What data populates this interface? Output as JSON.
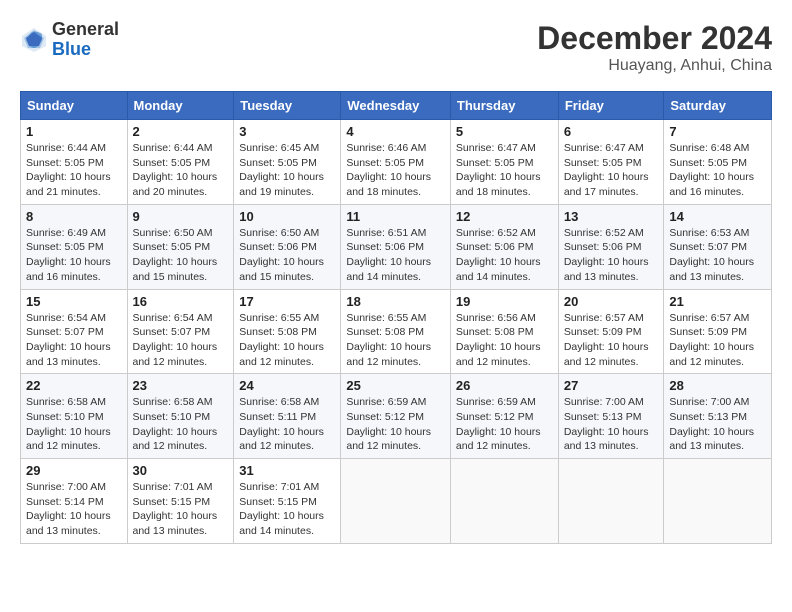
{
  "header": {
    "logo_general": "General",
    "logo_blue": "Blue",
    "month_title": "December 2024",
    "location": "Huayang, Anhui, China"
  },
  "days_of_week": [
    "Sunday",
    "Monday",
    "Tuesday",
    "Wednesday",
    "Thursday",
    "Friday",
    "Saturday"
  ],
  "weeks": [
    [
      {
        "day": "1",
        "info": "Sunrise: 6:44 AM\nSunset: 5:05 PM\nDaylight: 10 hours\nand 21 minutes."
      },
      {
        "day": "2",
        "info": "Sunrise: 6:44 AM\nSunset: 5:05 PM\nDaylight: 10 hours\nand 20 minutes."
      },
      {
        "day": "3",
        "info": "Sunrise: 6:45 AM\nSunset: 5:05 PM\nDaylight: 10 hours\nand 19 minutes."
      },
      {
        "day": "4",
        "info": "Sunrise: 6:46 AM\nSunset: 5:05 PM\nDaylight: 10 hours\nand 18 minutes."
      },
      {
        "day": "5",
        "info": "Sunrise: 6:47 AM\nSunset: 5:05 PM\nDaylight: 10 hours\nand 18 minutes."
      },
      {
        "day": "6",
        "info": "Sunrise: 6:47 AM\nSunset: 5:05 PM\nDaylight: 10 hours\nand 17 minutes."
      },
      {
        "day": "7",
        "info": "Sunrise: 6:48 AM\nSunset: 5:05 PM\nDaylight: 10 hours\nand 16 minutes."
      }
    ],
    [
      {
        "day": "8",
        "info": "Sunrise: 6:49 AM\nSunset: 5:05 PM\nDaylight: 10 hours\nand 16 minutes."
      },
      {
        "day": "9",
        "info": "Sunrise: 6:50 AM\nSunset: 5:05 PM\nDaylight: 10 hours\nand 15 minutes."
      },
      {
        "day": "10",
        "info": "Sunrise: 6:50 AM\nSunset: 5:06 PM\nDaylight: 10 hours\nand 15 minutes."
      },
      {
        "day": "11",
        "info": "Sunrise: 6:51 AM\nSunset: 5:06 PM\nDaylight: 10 hours\nand 14 minutes."
      },
      {
        "day": "12",
        "info": "Sunrise: 6:52 AM\nSunset: 5:06 PM\nDaylight: 10 hours\nand 14 minutes."
      },
      {
        "day": "13",
        "info": "Sunrise: 6:52 AM\nSunset: 5:06 PM\nDaylight: 10 hours\nand 13 minutes."
      },
      {
        "day": "14",
        "info": "Sunrise: 6:53 AM\nSunset: 5:07 PM\nDaylight: 10 hours\nand 13 minutes."
      }
    ],
    [
      {
        "day": "15",
        "info": "Sunrise: 6:54 AM\nSunset: 5:07 PM\nDaylight: 10 hours\nand 13 minutes."
      },
      {
        "day": "16",
        "info": "Sunrise: 6:54 AM\nSunset: 5:07 PM\nDaylight: 10 hours\nand 12 minutes."
      },
      {
        "day": "17",
        "info": "Sunrise: 6:55 AM\nSunset: 5:08 PM\nDaylight: 10 hours\nand 12 minutes."
      },
      {
        "day": "18",
        "info": "Sunrise: 6:55 AM\nSunset: 5:08 PM\nDaylight: 10 hours\nand 12 minutes."
      },
      {
        "day": "19",
        "info": "Sunrise: 6:56 AM\nSunset: 5:08 PM\nDaylight: 10 hours\nand 12 minutes."
      },
      {
        "day": "20",
        "info": "Sunrise: 6:57 AM\nSunset: 5:09 PM\nDaylight: 10 hours\nand 12 minutes."
      },
      {
        "day": "21",
        "info": "Sunrise: 6:57 AM\nSunset: 5:09 PM\nDaylight: 10 hours\nand 12 minutes."
      }
    ],
    [
      {
        "day": "22",
        "info": "Sunrise: 6:58 AM\nSunset: 5:10 PM\nDaylight: 10 hours\nand 12 minutes."
      },
      {
        "day": "23",
        "info": "Sunrise: 6:58 AM\nSunset: 5:10 PM\nDaylight: 10 hours\nand 12 minutes."
      },
      {
        "day": "24",
        "info": "Sunrise: 6:58 AM\nSunset: 5:11 PM\nDaylight: 10 hours\nand 12 minutes."
      },
      {
        "day": "25",
        "info": "Sunrise: 6:59 AM\nSunset: 5:12 PM\nDaylight: 10 hours\nand 12 minutes."
      },
      {
        "day": "26",
        "info": "Sunrise: 6:59 AM\nSunset: 5:12 PM\nDaylight: 10 hours\nand 12 minutes."
      },
      {
        "day": "27",
        "info": "Sunrise: 7:00 AM\nSunset: 5:13 PM\nDaylight: 10 hours\nand 13 minutes."
      },
      {
        "day": "28",
        "info": "Sunrise: 7:00 AM\nSunset: 5:13 PM\nDaylight: 10 hours\nand 13 minutes."
      }
    ],
    [
      {
        "day": "29",
        "info": "Sunrise: 7:00 AM\nSunset: 5:14 PM\nDaylight: 10 hours\nand 13 minutes."
      },
      {
        "day": "30",
        "info": "Sunrise: 7:01 AM\nSunset: 5:15 PM\nDaylight: 10 hours\nand 13 minutes."
      },
      {
        "day": "31",
        "info": "Sunrise: 7:01 AM\nSunset: 5:15 PM\nDaylight: 10 hours\nand 14 minutes."
      },
      {
        "day": "",
        "info": ""
      },
      {
        "day": "",
        "info": ""
      },
      {
        "day": "",
        "info": ""
      },
      {
        "day": "",
        "info": ""
      }
    ]
  ]
}
